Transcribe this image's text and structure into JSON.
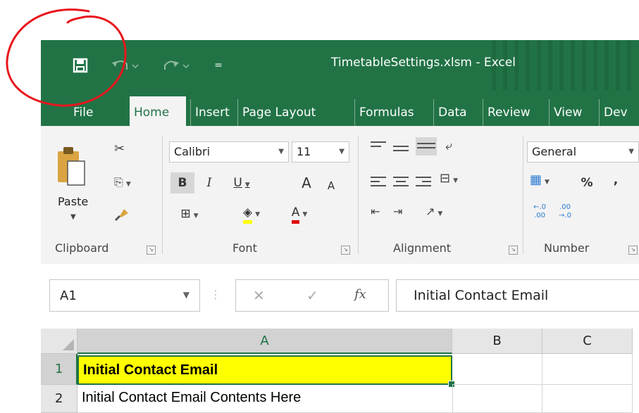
{
  "window": {
    "title": "TimetableSettings.xlsm  -  Excel"
  },
  "qat": {
    "customize_glyph": "="
  },
  "tabs": [
    {
      "label": "File"
    },
    {
      "label": "Home"
    },
    {
      "label": "Insert"
    },
    {
      "label": "Page Layout"
    },
    {
      "label": "Formulas"
    },
    {
      "label": "Data"
    },
    {
      "label": "Review"
    },
    {
      "label": "View"
    },
    {
      "label": "Dev"
    }
  ],
  "ribbon": {
    "clipboard": {
      "paste_label": "Paste",
      "group_label": "Clipboard"
    },
    "font": {
      "font_name": "Calibri",
      "font_size": "11",
      "bold": "B",
      "italic": "I",
      "underline": "U",
      "grow": "A",
      "shrink": "A",
      "font_color_letter": "A",
      "group_label": "Font",
      "highlight_color": "#ffff00",
      "font_color": "#e00000"
    },
    "alignment": {
      "group_label": "Alignment"
    },
    "number": {
      "format": "General",
      "percent": "%",
      "comma": ",",
      "inc_decimal": "←.0\n.00",
      "dec_decimal": ".00\n→.0",
      "group_label": "Number"
    }
  },
  "formula_bar": {
    "name_box": "A1",
    "cancel": "✕",
    "enter": "✓",
    "fx": "fx",
    "content": "Initial Contact Email"
  },
  "grid": {
    "columns": [
      "A",
      "B",
      "C"
    ],
    "rows": [
      {
        "num": "1",
        "a": "Initial Contact Email"
      },
      {
        "num": "2",
        "a": "Initial Contact Email Contents Here"
      }
    ],
    "selected_fill": "#ffff00",
    "accent": "#217346"
  },
  "annotation": {
    "color": "#e8151c"
  }
}
